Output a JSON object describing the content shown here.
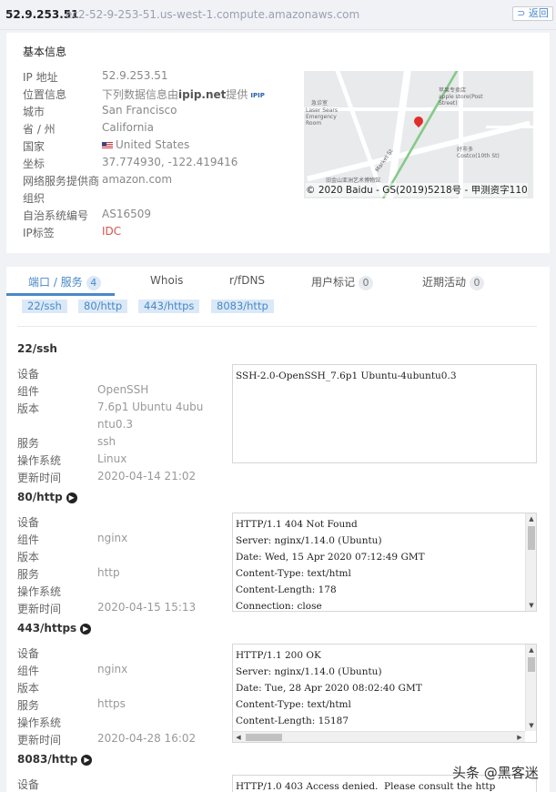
{
  "topbar": {
    "ip": "52.9.253.51",
    "hostname": "ec2-52-9-253-51.us-west-1.compute.amazonaws.com",
    "back_label": "⊃ 返回"
  },
  "basic_info": {
    "title": "基本信息",
    "rows": [
      {
        "label": "IP 地址",
        "value": "52.9.253.51"
      },
      {
        "label": "位置信息",
        "value": "下列数据信息由",
        "value_bold": "ipip.net",
        "value_suffix": "提供",
        "logo": "IPIP"
      },
      {
        "label": "城市",
        "value": "San Francisco"
      },
      {
        "label": "省 / 州",
        "value": "California"
      },
      {
        "label": "国家",
        "value": "United States",
        "icon": "us-flag-icon"
      },
      {
        "label": "坐标",
        "value": "37.774930, -122.419416"
      },
      {
        "label": "网络服务提供商",
        "value": "amazon.com"
      },
      {
        "label": "组织",
        "value": ""
      },
      {
        "label": "自治系统编号",
        "value": "AS16509"
      },
      {
        "label": "IP标签",
        "value": "IDC",
        "color": "#d9534f"
      }
    ],
    "map": {
      "copyright": "© 2020 Baidu - GS(2019)5218号 - 甲测资字110",
      "pois": [
        "急诊室",
        "Laser Sears Emergency Room",
        "苹果专卖店",
        "apple store(Post Street)",
        "好市多",
        "Costco(10th St)",
        "Market St",
        "旧金山亚洲艺术博物馆"
      ]
    }
  },
  "tabs": [
    {
      "label": "端口 / 服务",
      "count": "4",
      "active": true
    },
    {
      "label": "Whois"
    },
    {
      "label": "r/fDNS"
    },
    {
      "label": "用户标记",
      "count": "0"
    },
    {
      "label": "近期活动",
      "count": "0"
    }
  ],
  "port_chips": [
    "22/ssh",
    "80/http",
    "443/https",
    "8083/http"
  ],
  "field_labels": {
    "device": "设备",
    "component": "组件",
    "version": "版本",
    "service": "服务",
    "os": "操作系统",
    "updated": "更新时间"
  },
  "services": [
    {
      "title": "22/ssh",
      "component": "OpenSSH",
      "version_line1": "7.6p1 Ubuntu 4ubu",
      "version_line2": "ntu0.3",
      "service": "ssh",
      "os": "Linux",
      "updated": "2020-04-14 21:02",
      "banner": "SSH-2.0-OpenSSH_7.6p1 Ubuntu-4ubuntu0.3"
    },
    {
      "title": "80/http",
      "component": "nginx",
      "service": "http",
      "updated": "2020-04-15 15:13",
      "banner": "HTTP/1.1 404 Not Found\nServer: nginx/1.14.0 (Ubuntu)\nDate: Wed, 15 Apr 2020 07:12:49 GMT\nContent-Type: text/html\nContent-Length: 178\nConnection: close"
    },
    {
      "title": "443/https",
      "component": "nginx",
      "service": "https",
      "updated": "2020-04-28 16:02",
      "banner": "HTTP/1.1 200 OK\nServer: nginx/1.14.0 (Ubuntu)\nDate: Tue, 28 Apr 2020 08:02:40 GMT\nContent-Type: text/html\nContent-Length: 15187"
    },
    {
      "title": "8083/http",
      "banner": "HTTP/1.0 403 Access denied.  Please consult the http"
    }
  ],
  "watermark": "头条 @黑客迷",
  "colors": {
    "accent": "#4a88c7",
    "tag_red": "#d9534f",
    "page_bg": "#f1f2f6"
  }
}
